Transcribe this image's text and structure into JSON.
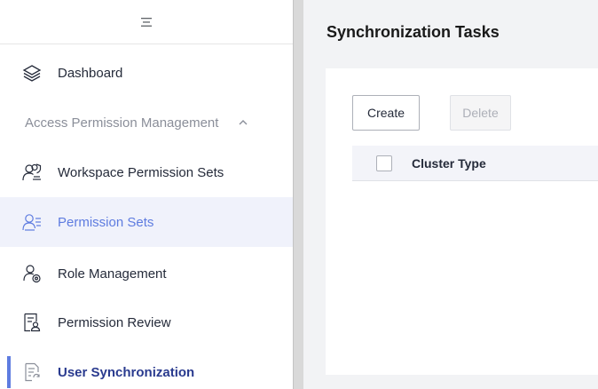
{
  "sidebar": {
    "toggle_icon": "menu-icon",
    "items": [
      {
        "label": "Dashboard",
        "icon": "layers-icon"
      },
      {
        "label": "Workspace Permission Sets",
        "icon": "users-shield-icon"
      },
      {
        "label": "Permission Sets",
        "icon": "user-list-icon",
        "state": "hover"
      },
      {
        "label": "Role Management",
        "icon": "user-settings-icon"
      },
      {
        "label": "Permission Review",
        "icon": "document-user-icon"
      },
      {
        "label": "User Synchronization",
        "icon": "document-sync-icon",
        "state": "selected"
      }
    ],
    "group": {
      "label": "Access Permission Management",
      "icon": "chevron-up-icon",
      "expanded": true
    }
  },
  "main": {
    "title": "Synchronization Tasks",
    "toolbar": {
      "create_label": "Create",
      "delete_label": "Delete"
    },
    "table": {
      "columns": [
        "Cluster Type"
      ]
    }
  },
  "colors": {
    "accent": "#5e7ce0",
    "selected_text": "#2a3b8f",
    "active_bg": "#f0f2fb",
    "main_bg": "#f2f3f5"
  }
}
